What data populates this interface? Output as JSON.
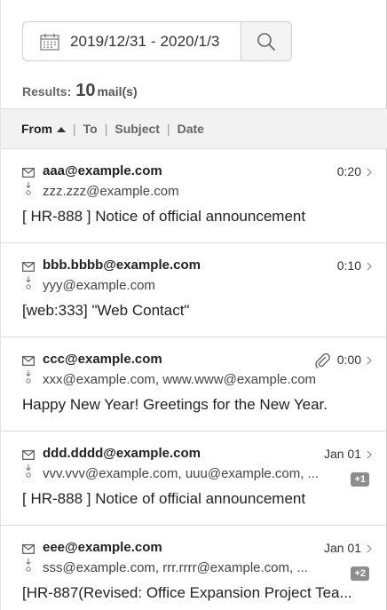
{
  "search": {
    "date_range": "2019/12/31 - 2020/1/3"
  },
  "results": {
    "label": "Results:",
    "count": "10",
    "unit": "mail(s)"
  },
  "sort": {
    "from": "From",
    "to": "To",
    "subject": "Subject",
    "date": "Date",
    "sep": "|"
  },
  "mails": [
    {
      "from": "aaa@example.com",
      "to": "zzz.zzz@example.com",
      "subject": "[ HR-888 ] Notice of official announcement",
      "time": "0:20"
    },
    {
      "from": "bbb.bbbb@example.com",
      "to": "yyy@example.com",
      "subject": "[web:333] \"Web Contact\"",
      "time": "0:10"
    },
    {
      "from": "ccc@example.com",
      "to": "xxx@example.com, www.www@example.com",
      "subject": "Happy New Year! Greetings for the New Year.",
      "time": "0:00",
      "attachment_icon": "paperclip-icon"
    },
    {
      "from": "ddd.dddd@example.com",
      "to": "vvv.vvv@example.com, uuu@example.com, ...",
      "subject": "[ HR-888 ] Notice of official announcement",
      "time": "Jan 01",
      "extra": "+1"
    },
    {
      "from": "eee@example.com",
      "to": "sss@example.com, rrr.rrrr@example.com, ...",
      "subject": "[HR-887(Revised: Office Expansion Project Tea...",
      "time": "Jan 01",
      "extra": "+2"
    }
  ]
}
